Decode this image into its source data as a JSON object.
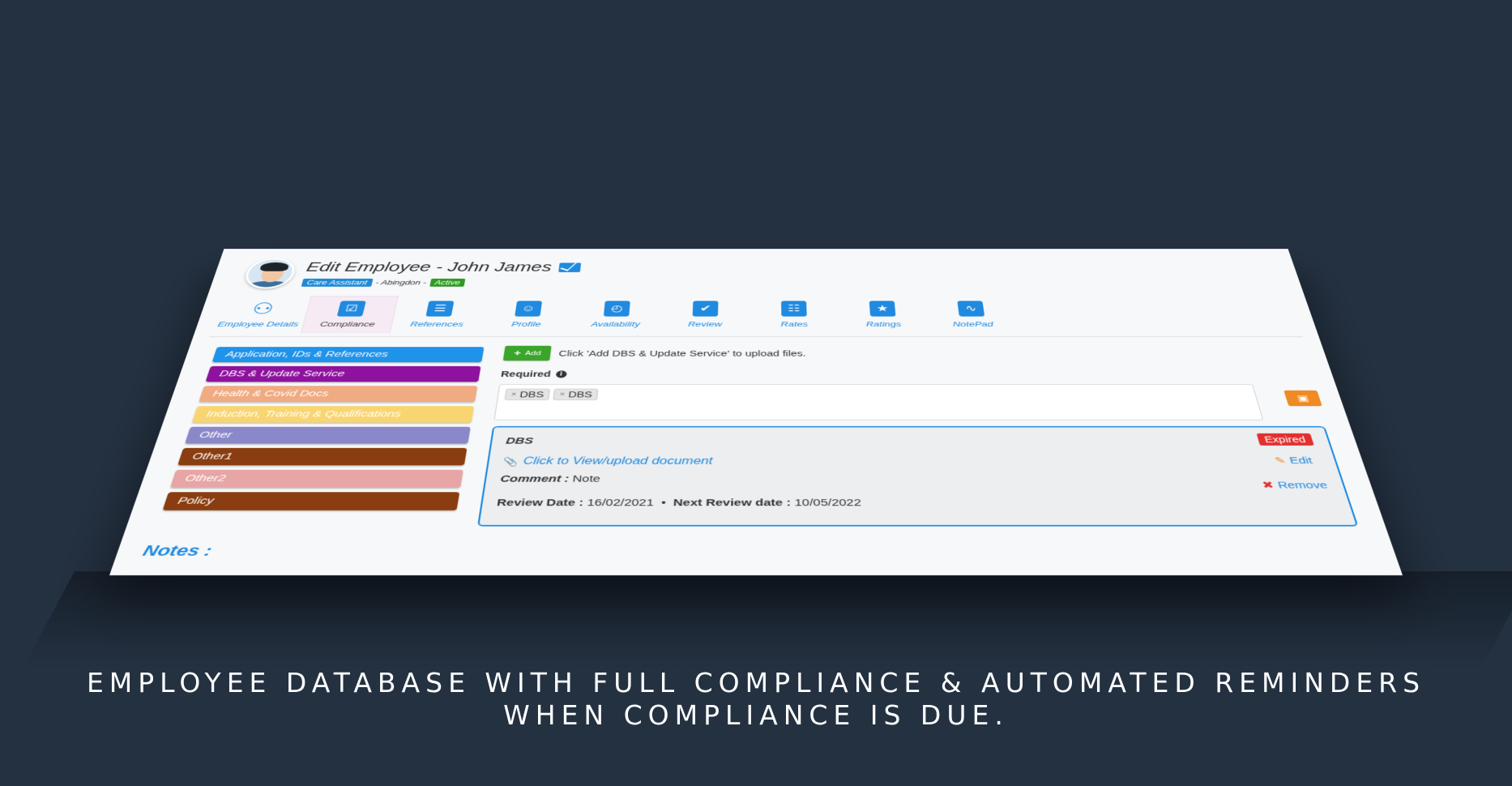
{
  "header": {
    "title": "Edit Employee - John James",
    "role_badge": "Care Assistant",
    "separator1": "- Abingdon -",
    "status_badge": "Active"
  },
  "tabs": [
    {
      "label": "Employee Details",
      "icon": "person-info-icon",
      "glyph": "⚇"
    },
    {
      "label": "Compliance",
      "icon": "clipboard-check-icon",
      "glyph": "☑"
    },
    {
      "label": "References",
      "icon": "list-document-icon",
      "glyph": "☰"
    },
    {
      "label": "Profile",
      "icon": "profile-card-icon",
      "glyph": "☺"
    },
    {
      "label": "Availability",
      "icon": "clock-icon",
      "glyph": "◴"
    },
    {
      "label": "Review",
      "icon": "user-check-icon",
      "glyph": "✔"
    },
    {
      "label": "Rates",
      "icon": "calculator-icon",
      "glyph": "☷"
    },
    {
      "label": "Ratings",
      "icon": "star-icon",
      "glyph": "★"
    },
    {
      "label": "NotePad",
      "icon": "notepad-icon",
      "glyph": "∿"
    }
  ],
  "active_tab": "Compliance",
  "categories": [
    {
      "label": "Application, IDs & References",
      "color": "#1f93ea"
    },
    {
      "label": "DBS & Update Service",
      "color": "#8e129e"
    },
    {
      "label": "Health & Covid Docs",
      "color": "#f0ab83"
    },
    {
      "label": "Induction, Training & Qualifications",
      "color": "#f9d571"
    },
    {
      "label": "Other",
      "color": "#8b88c9"
    },
    {
      "label": "Other1",
      "color": "#8a3d10"
    },
    {
      "label": "Other2",
      "color": "#e8a5a5"
    },
    {
      "label": "Policy",
      "color": "#8a3d10"
    }
  ],
  "notes_label": "Notes :",
  "main": {
    "add_label": "Add",
    "add_hint": "Click 'Add DBS & Update Service' to upload files.",
    "required_label": "Required",
    "tags": [
      "DBS",
      "DBS"
    ]
  },
  "document": {
    "title": "DBS",
    "status": "Expired",
    "view_link": "Click to View/upload document",
    "comment_label": "Comment :",
    "comment_value": "Note",
    "review_label": "Review Date :",
    "review_value": "16/02/2021",
    "dot": "•",
    "next_label": "Next Review date :",
    "next_value": "10/05/2022",
    "edit_label": "Edit",
    "remove_label": "Remove"
  },
  "caption": {
    "line1": "EMPLOYEE DATABASE WITH FULL COMPLIANCE & AUTOMATED REMINDERS",
    "line2": "WHEN COMPLIANCE IS DUE."
  },
  "colors": {
    "accent": "#1f8ae0",
    "background": "#243141",
    "add_green": "#3aa52a",
    "expired_red": "#e2302f",
    "save_orange": "#f08a22"
  }
}
